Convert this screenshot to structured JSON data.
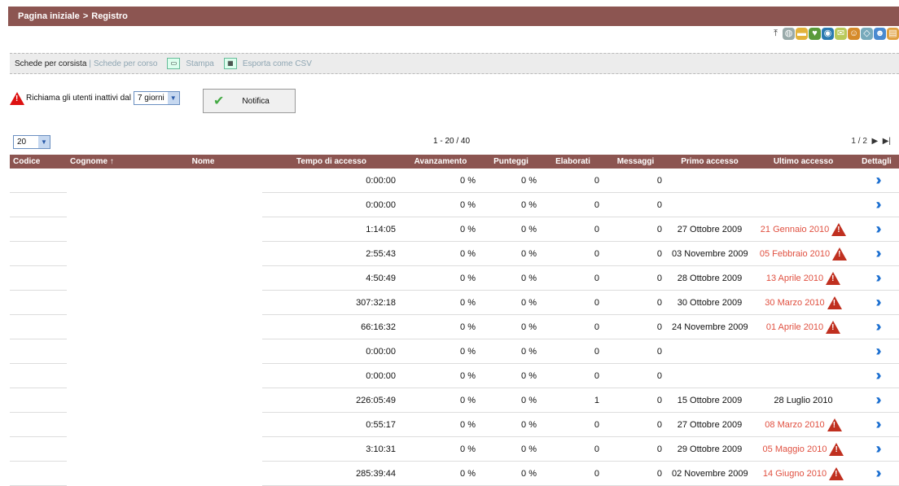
{
  "breadcrumb": {
    "home": "Pagina iniziale",
    "sep": ">",
    "current": "Registro"
  },
  "toolbar": {
    "tab1": "Schede per corsista",
    "sep": "|",
    "tab2": "Schede per corso",
    "print": "Stampa",
    "export": "Esporta come CSV"
  },
  "inactive": {
    "label": "Richiama gli utenti inattivi dal",
    "select_value": "7 giorni",
    "button": "Notifica"
  },
  "paging": {
    "per_page": "20",
    "range": "1 - 20 / 40",
    "pages": "1 / 2"
  },
  "columns": [
    "Codice",
    "Cognome ↑",
    "Nome",
    "Tempo di accesso",
    "Avanzamento",
    "Punteggi",
    "Elaborati",
    "Messaggi",
    "Primo accesso",
    "Ultimo accesso",
    "Dettagli"
  ],
  "rows": [
    {
      "codice": "",
      "cognome": "",
      "nome": "",
      "tempo": "0:00:00",
      "avanz": "0 %",
      "punt": "0 %",
      "elab": "0",
      "mess": "0",
      "primo": "",
      "ultimo": "",
      "warn": false
    },
    {
      "codice": "",
      "cognome": "",
      "nome": "",
      "tempo": "0:00:00",
      "avanz": "0 %",
      "punt": "0 %",
      "elab": "0",
      "mess": "0",
      "primo": "",
      "ultimo": "",
      "warn": false
    },
    {
      "codice": "",
      "cognome": "",
      "nome": "",
      "tempo": "1:14:05",
      "avanz": "0 %",
      "punt": "0 %",
      "elab": "0",
      "mess": "0",
      "primo": "27 Ottobre 2009",
      "ultimo": "21 Gennaio 2010",
      "warn": true
    },
    {
      "codice": "",
      "cognome": "",
      "nome": "",
      "tempo": "2:55:43",
      "avanz": "0 %",
      "punt": "0 %",
      "elab": "0",
      "mess": "0",
      "primo": "03 Novembre 2009",
      "ultimo": "05 Febbraio 2010",
      "warn": true
    },
    {
      "codice": "",
      "cognome": "",
      "nome": "",
      "tempo": "4:50:49",
      "avanz": "0 %",
      "punt": "0 %",
      "elab": "0",
      "mess": "0",
      "primo": "28 Ottobre 2009",
      "ultimo": "13 Aprile 2010",
      "warn": true
    },
    {
      "codice": "",
      "cognome": "",
      "nome": "",
      "tempo": "307:32:18",
      "avanz": "0 %",
      "punt": "0 %",
      "elab": "0",
      "mess": "0",
      "primo": "30 Ottobre 2009",
      "ultimo": "30 Marzo 2010",
      "warn": true
    },
    {
      "codice": "",
      "cognome": "",
      "nome": "",
      "tempo": "66:16:32",
      "avanz": "0 %",
      "punt": "0 %",
      "elab": "0",
      "mess": "0",
      "primo": "24 Novembre 2009",
      "ultimo": "01 Aprile 2010",
      "warn": true
    },
    {
      "codice": "",
      "cognome": "",
      "nome": "",
      "tempo": "0:00:00",
      "avanz": "0 %",
      "punt": "0 %",
      "elab": "0",
      "mess": "0",
      "primo": "",
      "ultimo": "",
      "warn": false
    },
    {
      "codice": "",
      "cognome": "",
      "nome": "",
      "tempo": "0:00:00",
      "avanz": "0 %",
      "punt": "0 %",
      "elab": "0",
      "mess": "0",
      "primo": "",
      "ultimo": "",
      "warn": false
    },
    {
      "codice": "",
      "cognome": "",
      "nome": "",
      "tempo": "226:05:49",
      "avanz": "0 %",
      "punt": "0 %",
      "elab": "1",
      "mess": "0",
      "primo": "15 Ottobre 2009",
      "ultimo": "28 Luglio 2010",
      "warn": false
    },
    {
      "codice": "",
      "cognome": "",
      "nome": "",
      "tempo": "0:55:17",
      "avanz": "0 %",
      "punt": "0 %",
      "elab": "0",
      "mess": "0",
      "primo": "27 Ottobre 2009",
      "ultimo": "08 Marzo 2010",
      "warn": true
    },
    {
      "codice": "",
      "cognome": "",
      "nome": "",
      "tempo": "3:10:31",
      "avanz": "0 %",
      "punt": "0 %",
      "elab": "0",
      "mess": "0",
      "primo": "29 Ottobre 2009",
      "ultimo": "05 Maggio 2010",
      "warn": true
    },
    {
      "codice": "",
      "cognome": "",
      "nome": "",
      "tempo": "285:39:44",
      "avanz": "0 %",
      "punt": "0 %",
      "elab": "0",
      "mess": "0",
      "primo": "02 Novembre 2009",
      "ultimo": "14 Giugno 2010",
      "warn": true
    }
  ],
  "icons": [
    "home-icon",
    "cd-icon",
    "folder-icon",
    "heart-icon",
    "globe-icon",
    "mail-icon",
    "users-icon",
    "tag-icon",
    "group-icon",
    "book-icon"
  ],
  "colors": {
    "header_bg": "#8c5551",
    "warn_text": "#e05040",
    "details": "#1c6fd0"
  }
}
